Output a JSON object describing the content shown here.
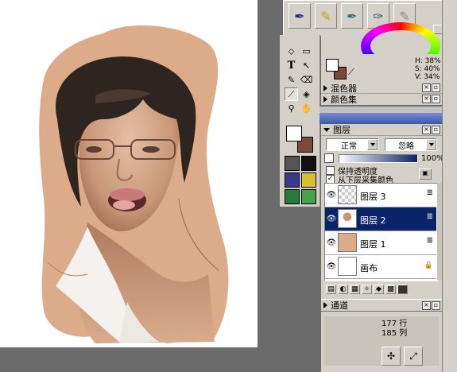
{
  "colors": {
    "skin_ground": "#dcab89",
    "hair": "#2e2420",
    "selection": "#0a246a",
    "swatch_fg": "#ffffff",
    "swatch_bg": "#7a4a36"
  },
  "color_readout": {
    "h": "H: 38%",
    "s": "S: 40%",
    "v": "V: 34%"
  },
  "panels": {
    "mixer": "混色器",
    "color_set": "颜色集",
    "layers": "图层",
    "channels": "通道"
  },
  "layers_panel": {
    "blend_mode": "正常",
    "ignore": "忽略",
    "opacity": "100%",
    "preserve_transparency": "保持透明度",
    "sample_below": "从下层采集颜色",
    "items": [
      {
        "name": "图层 3",
        "selected": false
      },
      {
        "name": "图层 2",
        "selected": true
      },
      {
        "name": "图层 1",
        "selected": false
      },
      {
        "name": "画布",
        "selected": false
      }
    ]
  },
  "info": {
    "rows": "177 行",
    "cols": "185 列"
  },
  "icons": [
    "pen-blue-icon",
    "pen-yellow-icon",
    "pen-ink-icon",
    "pen-nib-icon",
    "pen-white-icon",
    "move-icon",
    "text-icon",
    "pointer-icon",
    "eyedropper-icon",
    "brush-icon",
    "fill-icon",
    "zoom-icon",
    "hand-icon",
    "eye-icon",
    "lock-icon",
    "trash-icon"
  ]
}
